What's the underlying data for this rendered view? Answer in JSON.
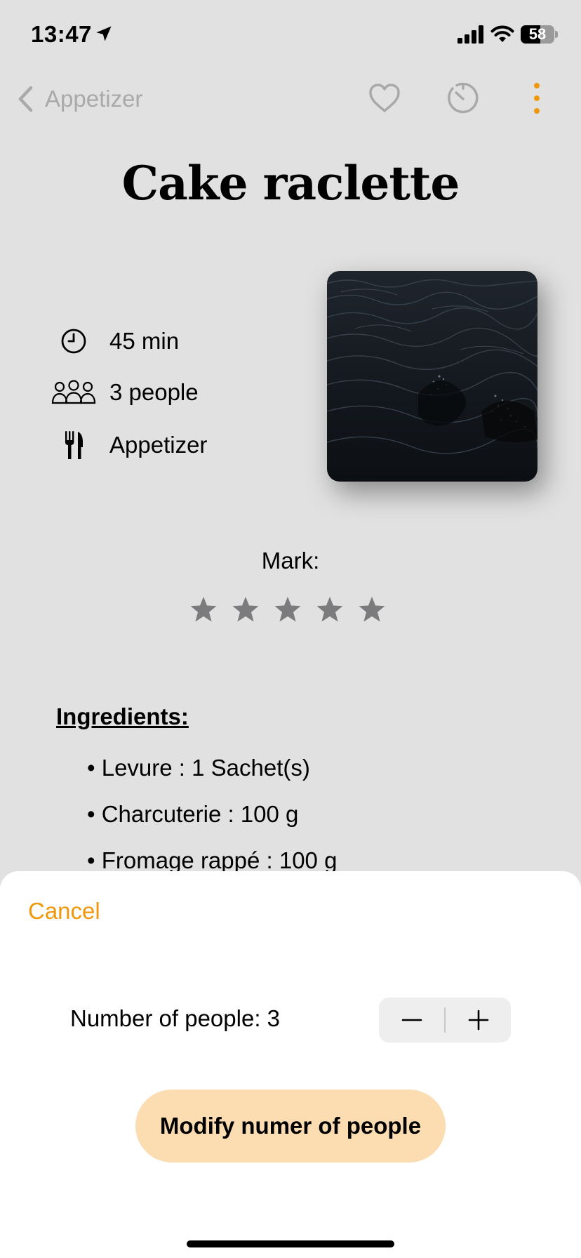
{
  "status_bar": {
    "time": "13:47",
    "battery_level": "58",
    "battery_fraction": 0.58
  },
  "nav": {
    "back_label": "Appetizer",
    "icons": [
      "chevron-left-icon",
      "heart-icon",
      "timer-icon",
      "more-vertical-icon"
    ]
  },
  "recipe": {
    "title": "Cake raclette",
    "time": "45 min",
    "servings": "3 people",
    "category": "Appetizer",
    "info_icons": [
      "clock-icon",
      "people-icon",
      "fork-knife-icon"
    ]
  },
  "rating": {
    "label": "Mark:",
    "max": 5,
    "value": 0
  },
  "ingredients": {
    "title": "Ingredients:",
    "items": [
      "• Levure : 1 Sachet(s)",
      "• Charcuterie : 100 g",
      "• Fromage rappé : 100 g"
    ]
  },
  "sheet": {
    "cancel_label": "Cancel",
    "people_label": "Number of people: 3",
    "modify_label": "Modify numer of people"
  },
  "colors": {
    "accent": "#f0980b",
    "button_bg": "#fcdcb1",
    "page_bg": "#e1e1e1",
    "star": "#7b7b7d"
  }
}
